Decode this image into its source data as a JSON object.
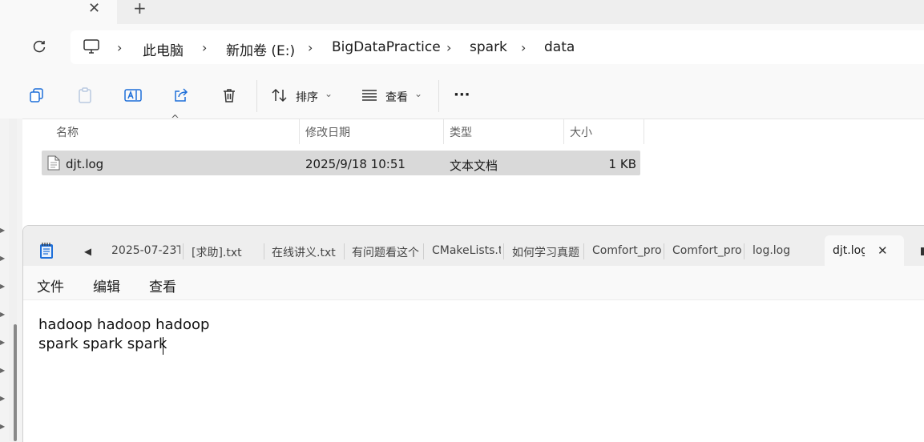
{
  "explorer": {
    "tab": {
      "close_glyph": "✕",
      "new_tab_glyph": "+"
    },
    "refresh_glyph": "⟳",
    "breadcrumb": [
      {
        "label": "此电脑"
      },
      {
        "label": "新加卷 (E:)"
      },
      {
        "label": "BigDataPractice"
      },
      {
        "label": "spark"
      },
      {
        "label": "data"
      }
    ],
    "separator_glyph": "›",
    "toolbar": {
      "sort_label": "排序",
      "view_label": "查看",
      "more_glyph": "···",
      "dropdown_glyph": "⌄"
    },
    "columns": {
      "name": "名称",
      "modified": "修改日期",
      "type": "类型",
      "size": "大小",
      "sort_indicator": "^"
    },
    "files": [
      {
        "name": "djt.log",
        "modified": "2025/9/18 10:51",
        "type": "文本文档",
        "size": "1 KB"
      }
    ]
  },
  "notepad": {
    "scroll_left_glyph": "◀",
    "tabs": [
      {
        "label": "2025-07-23T"
      },
      {
        "label": "[求助].txt"
      },
      {
        "label": "在线讲义.txt"
      },
      {
        "label": "有问题看这个"
      },
      {
        "label": "CMakeLists.t"
      },
      {
        "label": "如何学习真题"
      },
      {
        "label": "Comfort_pro"
      },
      {
        "label": "Comfort_pro"
      },
      {
        "label": "log.log"
      }
    ],
    "active_tab": {
      "label": "djt.log",
      "close_glyph": "✕"
    },
    "menu": {
      "file": "文件",
      "edit": "编辑",
      "view": "查看"
    },
    "content": [
      "hadoop hadoop hadoop",
      "spark spark spark"
    ]
  },
  "colors": {
    "selection": "#d9d9d9",
    "notepad_icon": "#1e6fd9"
  }
}
